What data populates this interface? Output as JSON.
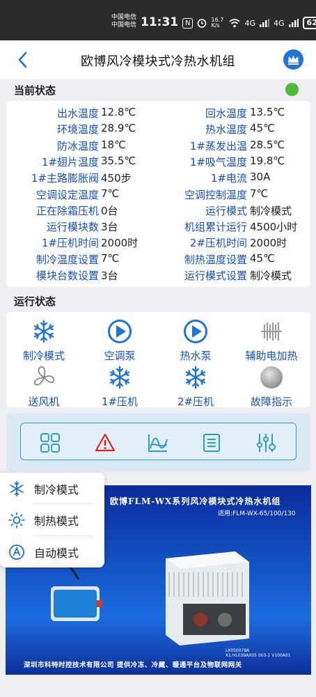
{
  "statusbar": {
    "carrier1": "中国电信",
    "carrier2": "中国电信",
    "time": "11:31",
    "nfc": "N",
    "speed": "16.7 K/s",
    "net1": "4G",
    "net2": "4G",
    "battery": "62"
  },
  "header": {
    "title": "欧博风冷模块式冷热水机组"
  },
  "current_status": {
    "title": "当前状态",
    "indicator_color": "#4cba3a",
    "rows": [
      {
        "l1": "出水温度",
        "v1": "12.8℃",
        "l2": "回水温度",
        "v2": "13.5℃"
      },
      {
        "l1": "环境温度",
        "v1": "28.9℃",
        "l2": "热水温度",
        "v2": "45℃"
      },
      {
        "l1": "防冰温度",
        "v1": "18℃",
        "l2": "1#蒸发出温",
        "v2": "28.5℃"
      },
      {
        "l1": "1#翅片温度",
        "v1": "35.5℃",
        "l2": "1#吸气温度",
        "v2": "19.8℃"
      },
      {
        "l1": "1#主路膨胀阀",
        "v1": "450步",
        "l2": "1#电流",
        "v2": "30A"
      },
      {
        "l1": "空调设定温度",
        "v1": "7℃",
        "l2": "空调控制温度",
        "v2": "7℃"
      },
      {
        "l1": "正在除霜压机",
        "v1": "0台",
        "l2": "运行模式",
        "v2": "制冷模式"
      },
      {
        "l1": "运行模块数",
        "v1": "3台",
        "l2": "机组累计运行",
        "v2": "4500小时"
      },
      {
        "l1": "1#压机时间",
        "v1": "2000时",
        "l2": "2#压机时间",
        "v2": "2000时"
      },
      {
        "l1": "制冷温度设置",
        "v1": "7℃",
        "l2": "制热温度设置",
        "v2": "45℃"
      },
      {
        "l1": "模块台数设置",
        "v1": "3台",
        "l2": "运行模式设置",
        "v2": "制冷模式"
      }
    ]
  },
  "operation_status": {
    "title": "运行状态",
    "items": [
      {
        "label": "制冷模式",
        "icon": "snowflake-icon"
      },
      {
        "label": "空调泵",
        "icon": "play-circle-icon"
      },
      {
        "label": "热水泵",
        "icon": "play-circle-icon"
      },
      {
        "label": "辅助电加热",
        "icon": "heater-icon"
      },
      {
        "label": "送风机",
        "icon": "fan-icon"
      },
      {
        "label": "1#压机",
        "icon": "snowflake-icon"
      },
      {
        "label": "2#压机",
        "icon": "snowflake-icon"
      },
      {
        "label": "故障指示",
        "icon": "fault-dot-icon"
      }
    ]
  },
  "toolbar": {
    "items": [
      "grid-icon",
      "warning-icon",
      "chart-icon",
      "list-icon",
      "settings-sliders-icon"
    ]
  },
  "mode_menu": {
    "items": [
      {
        "label": "制冷模式",
        "icon": "snowflake-icon"
      },
      {
        "label": "制热模式",
        "icon": "sun-icon"
      },
      {
        "label": "自动模式",
        "icon": "auto-icon"
      }
    ]
  },
  "banner": {
    "title": "欧博FLM-WX系列风冷模块式冷热水机组",
    "subtitle": "适用:FLM-WX-65/100/130",
    "code1": "LK050078A",
    "code2": "X1.HL039AX05 003-1 V100A01",
    "footer": "深圳市科特时控技术有限公司   提供冷冻、冷藏、暖通平台及物联网网关"
  },
  "colors": {
    "accent": "#1650c4",
    "icon_blue": "#1f74d9",
    "warning": "#e02424",
    "toolbar_teal": "#2a9ec9"
  }
}
